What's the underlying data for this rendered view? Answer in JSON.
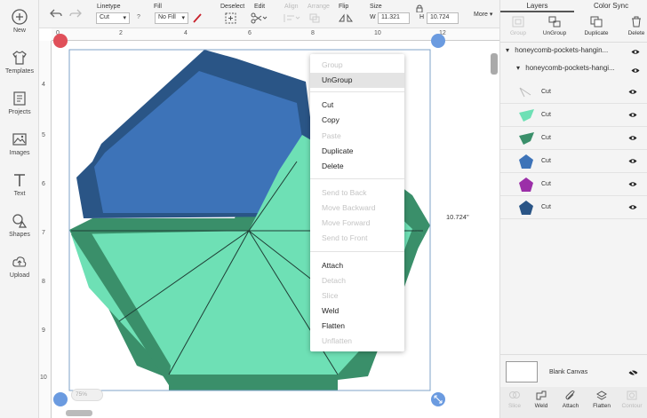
{
  "sidebar": {
    "items": [
      {
        "label": "New",
        "icon": "plus-circle-icon"
      },
      {
        "label": "Templates",
        "icon": "shirt-icon"
      },
      {
        "label": "Projects",
        "icon": "projects-icon"
      },
      {
        "label": "Images",
        "icon": "image-icon"
      },
      {
        "label": "Text",
        "icon": "text-icon"
      },
      {
        "label": "Shapes",
        "icon": "shapes-icon"
      },
      {
        "label": "Upload",
        "icon": "upload-icon"
      }
    ]
  },
  "toolbar": {
    "linetype_label": "Linetype",
    "linetype_value": "Cut",
    "help_mark": "?",
    "fill_label": "Fill",
    "fill_value": "No Fill",
    "deselect_label": "Deselect",
    "edit_label": "Edit",
    "align_label": "Align",
    "arrange_label": "Arrange",
    "flip_label": "Flip",
    "size_label": "Size",
    "w_label": "W",
    "w_value": "11.321",
    "h_label": "H",
    "h_value": "10.724",
    "more_label": "More"
  },
  "ruler": {
    "h_numbers": [
      "0",
      "2",
      "4",
      "6",
      "8",
      "10",
      "12"
    ],
    "v_numbers": [
      "4",
      "5",
      "6",
      "7",
      "8",
      "9",
      "10"
    ]
  },
  "canvas": {
    "height_readout": "10.724\"",
    "zoom": "75%",
    "colors": {
      "dark_blue": "#2a5586",
      "mid_blue": "#3d73b8",
      "dark_green": "#3a8f6a",
      "mint": "#6ee0b5"
    }
  },
  "context_menu": {
    "items": [
      {
        "label": "Group",
        "enabled": false
      },
      {
        "label": "UnGroup",
        "enabled": true,
        "highlighted": true
      },
      {
        "label": "Cut",
        "enabled": true
      },
      {
        "label": "Copy",
        "enabled": true
      },
      {
        "label": "Paste",
        "enabled": false
      },
      {
        "label": "Duplicate",
        "enabled": true
      },
      {
        "label": "Delete",
        "enabled": true
      },
      {
        "label": "Send to Back",
        "enabled": false
      },
      {
        "label": "Move Backward",
        "enabled": false
      },
      {
        "label": "Move Forward",
        "enabled": false
      },
      {
        "label": "Send to Front",
        "enabled": false
      },
      {
        "label": "Attach",
        "enabled": true
      },
      {
        "label": "Detach",
        "enabled": false
      },
      {
        "label": "Slice",
        "enabled": false
      },
      {
        "label": "Weld",
        "enabled": true
      },
      {
        "label": "Flatten",
        "enabled": true
      },
      {
        "label": "Unflatten",
        "enabled": false
      }
    ]
  },
  "panel": {
    "tabs": [
      "Layers",
      "Color Sync"
    ],
    "actions": [
      {
        "label": "Group",
        "enabled": false
      },
      {
        "label": "UnGroup",
        "enabled": true
      },
      {
        "label": "Duplicate",
        "enabled": true
      },
      {
        "label": "Delete",
        "enabled": true
      }
    ],
    "group_name": "honeycomb-pockets-hangin...",
    "subgroup_name": "honeycomb-pockets-hangi...",
    "layers": [
      {
        "name": "Cut",
        "swatch": "line",
        "color": "#bbbbbb"
      },
      {
        "name": "Cut",
        "swatch": "leaf",
        "color": "#6ee0b5"
      },
      {
        "name": "Cut",
        "swatch": "leaf",
        "color": "#3a8f6a"
      },
      {
        "name": "Cut",
        "swatch": "pentagon",
        "color": "#3d73b8"
      },
      {
        "name": "Cut",
        "swatch": "pentagon",
        "color": "#9b2fa8"
      },
      {
        "name": "Cut",
        "swatch": "pentagon",
        "color": "#2a5586"
      }
    ],
    "blank_canvas_label": "Blank Canvas",
    "bottom_actions": [
      {
        "label": "Slice",
        "enabled": false
      },
      {
        "label": "Weld",
        "enabled": true
      },
      {
        "label": "Attach",
        "enabled": true
      },
      {
        "label": "Flatten",
        "enabled": true
      },
      {
        "label": "Contour",
        "enabled": false
      }
    ]
  }
}
